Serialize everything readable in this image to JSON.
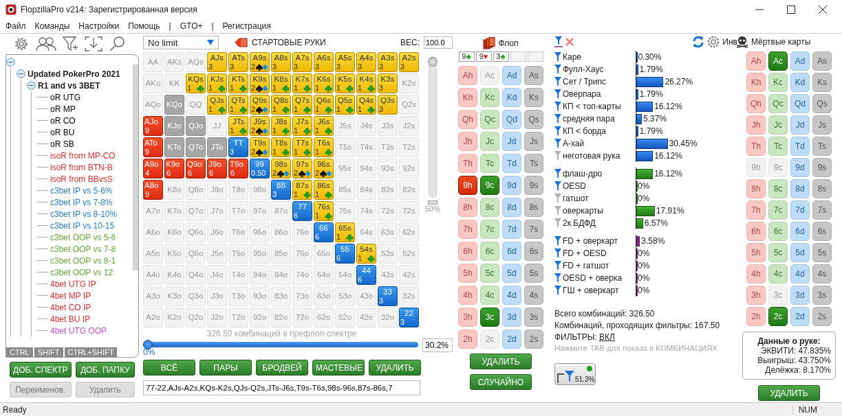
{
  "window": {
    "title": "FlopzillaPro v214: Зарегистрированная версия"
  },
  "menu": [
    "Файл",
    "Команды",
    "Настройки",
    "Помощь",
    "|",
    "GTO+",
    "|",
    "Регистрация"
  ],
  "tree": {
    "expanded": true,
    "children": [
      {
        "label": "Updated PokerPro 2021",
        "expanded": true,
        "children": [
          {
            "label": "R1 and vs 3BET",
            "expanded": true,
            "children": [
              {
                "label": "oR UTG",
                "color": "#000000"
              },
              {
                "label": "oR MP",
                "color": "#000000"
              },
              {
                "label": "oR CO",
                "color": "#000000"
              },
              {
                "label": "oR BU",
                "color": "#000000"
              },
              {
                "label": "oR SB",
                "color": "#000000"
              },
              {
                "label": "isoR from MP-CO",
                "color": "#d83030"
              },
              {
                "label": "isoR from BTN-B",
                "color": "#d83030"
              },
              {
                "label": "isoR from BBvsS",
                "color": "#d83030"
              },
              {
                "label": "c3bet IP vs 5-6%",
                "color": "#2a7fc0"
              },
              {
                "label": "c3bet IP vs 7-8%",
                "color": "#2a7fc0"
              },
              {
                "label": "c3bet IP vs 8-10%",
                "color": "#2a7fc0"
              },
              {
                "label": "c3bet IP vs 10-15",
                "color": "#2a7fc0"
              },
              {
                "label": "c3bet OOP vs 5-6",
                "color": "#6aa63a"
              },
              {
                "label": "c3bet OOP vs 7-8",
                "color": "#6aa63a"
              },
              {
                "label": "c3bet OOP vs 8-1",
                "color": "#6aa63a"
              },
              {
                "label": "c3bet OOP vs 12",
                "color": "#6aa63a"
              },
              {
                "label": "4bet UTG IP",
                "color": "#d83030"
              },
              {
                "label": "4bet MP IP",
                "color": "#d83030"
              },
              {
                "label": "4bet CO IP",
                "color": "#d83030"
              },
              {
                "label": "4bet BU IP",
                "color": "#d83030"
              },
              {
                "label": "4bet UTG OOP",
                "color": "#c850c8"
              }
            ]
          }
        ]
      }
    ]
  },
  "modifier_tabs": [
    "CTRL",
    "SHIFT",
    "CTRL+SHIFT"
  ],
  "range_buttons": [
    {
      "label": "ДОБ. СПЕКТР",
      "disabled": false
    },
    {
      "label": "ДОБ. ПАПКУ",
      "disabled": false
    },
    {
      "label": "Переименов.",
      "disabled": true
    },
    {
      "label": "Удалить",
      "disabled": true
    }
  ],
  "matrix": {
    "game_select": "No limit",
    "title": "СТАРТОВЫЕ РУКИ",
    "weight_label": "ВЕС:",
    "weight_value": "100.0",
    "rows": [
      [
        {
          "label": "AA",
          "kind": "empty"
        },
        {
          "label": "AKs",
          "kind": "empty"
        },
        {
          "label": "AQs",
          "kind": "empty"
        },
        {
          "label": "AJs",
          "kind": "yellow",
          "count": "3"
        },
        {
          "label": "ATs",
          "kind": "yellow",
          "count": "3"
        },
        {
          "label": "A9s",
          "kind": "yellow",
          "count": "2",
          "suit_icon": {
            "kind": "spade_diamond"
          }
        },
        {
          "label": "A8s",
          "kind": "yellow",
          "count": "3"
        },
        {
          "label": "A7s",
          "kind": "yellow",
          "count": "3"
        },
        {
          "label": "A6s",
          "kind": "yellow",
          "count": "3"
        },
        {
          "label": "A5s",
          "kind": "yellow",
          "count": "3"
        },
        {
          "label": "A4s",
          "kind": "yellow",
          "count": "3"
        },
        {
          "label": "A3s",
          "kind": "yellow",
          "count": "3"
        },
        {
          "label": "A2s",
          "kind": "yellow",
          "count": "3"
        }
      ],
      [
        {
          "label": "AKo",
          "kind": "empty"
        },
        {
          "label": "KK",
          "kind": "empty"
        },
        {
          "label": "KQs",
          "kind": "yellow",
          "count": "1",
          "suit_icon": {
            "kind": "club"
          }
        },
        {
          "label": "KJs",
          "kind": "yellow",
          "count": "1",
          "suit_icon": {
            "kind": "club"
          }
        },
        {
          "label": "KTs",
          "kind": "yellow",
          "count": "1",
          "suit_icon": {
            "kind": "club"
          }
        },
        {
          "label": "K9s",
          "kind": "yellow",
          "count": "2",
          "suit_icon": {
            "kind": "spade_diamond"
          }
        },
        {
          "label": "K8s",
          "kind": "yellow",
          "count": "1",
          "suit_icon": {
            "kind": "club"
          }
        },
        {
          "label": "K7s",
          "kind": "yellow",
          "count": "1",
          "suit_icon": {
            "kind": "club"
          }
        },
        {
          "label": "K6s",
          "kind": "yellow",
          "count": "1",
          "suit_icon": {
            "kind": "club"
          }
        },
        {
          "label": "K5s",
          "kind": "yellow",
          "count": "1",
          "suit_icon": {
            "kind": "club"
          }
        },
        {
          "label": "K4s",
          "kind": "yellow",
          "count": "1",
          "suit_icon": {
            "kind": "club"
          }
        },
        {
          "label": "K3s",
          "kind": "yellow",
          "count": "3"
        },
        {
          "label": "K2s",
          "kind": "empty"
        }
      ],
      [
        {
          "label": "AQo",
          "kind": "empty"
        },
        {
          "label": "KQo",
          "kind": "gray"
        },
        {
          "label": "QQ",
          "kind": "empty"
        },
        {
          "label": "QJs",
          "kind": "yellow",
          "count": "1",
          "suit_icon": {
            "kind": "club"
          }
        },
        {
          "label": "QTs",
          "kind": "yellow",
          "count": "1",
          "suit_icon": {
            "kind": "club"
          }
        },
        {
          "label": "Q9s",
          "kind": "yellow",
          "count": "2",
          "suit_icon": {
            "kind": "spade_diamond"
          }
        },
        {
          "label": "Q8s",
          "kind": "yellow",
          "count": "1",
          "suit_icon": {
            "kind": "club"
          }
        },
        {
          "label": "Q7s",
          "kind": "yellow",
          "count": "1",
          "suit_icon": {
            "kind": "club"
          }
        },
        {
          "label": "Q6s",
          "kind": "yellow",
          "count": "1",
          "suit_icon": {
            "kind": "club"
          }
        },
        {
          "label": "Q5s",
          "kind": "yellow",
          "count": "1",
          "suit_icon": {
            "kind": "club"
          }
        },
        {
          "label": "Q4s",
          "kind": "yellow",
          "count": "1",
          "suit_icon": {
            "kind": "club"
          }
        },
        {
          "label": "Q3s",
          "kind": "yellow",
          "count": "3"
        },
        {
          "label": "Q2s",
          "kind": "empty"
        }
      ],
      [
        {
          "label": "AJo",
          "kind": "red",
          "count": "9"
        },
        {
          "label": "KJo",
          "kind": "gray"
        },
        {
          "label": "QJo",
          "kind": "gray"
        },
        {
          "label": "JJ",
          "kind": "empty"
        },
        {
          "label": "JTs",
          "kind": "yellow",
          "count": "1",
          "suit_icon": {
            "kind": "club"
          }
        },
        {
          "label": "J9s",
          "kind": "yellow",
          "count": "2",
          "suit_icon": {
            "kind": "spade_diamond"
          }
        },
        {
          "label": "J8s",
          "kind": "yellow",
          "count": "1",
          "suit_icon": {
            "kind": "club"
          }
        },
        {
          "label": "J7s",
          "kind": "yellow",
          "count": "1",
          "suit_icon": {
            "kind": "club"
          }
        },
        {
          "label": "J6s",
          "kind": "yellow",
          "count": "1",
          "suit_icon": {
            "kind": "club"
          }
        },
        {
          "label": "J5s",
          "kind": "empty"
        },
        {
          "label": "J4s",
          "kind": "empty"
        },
        {
          "label": "J3s",
          "kind": "empty"
        },
        {
          "label": "J2s",
          "kind": "empty"
        }
      ],
      [
        {
          "label": "ATo",
          "kind": "red",
          "count": "9"
        },
        {
          "label": "KTo",
          "kind": "gray"
        },
        {
          "label": "QTo",
          "kind": "gray"
        },
        {
          "label": "JTo",
          "kind": "gray"
        },
        {
          "label": "TT",
          "kind": "blue",
          "count": "3"
        },
        {
          "label": "T9s",
          "kind": "yellow",
          "count": "2",
          "suit_icon": {
            "kind": "spade_diamond"
          }
        },
        {
          "label": "T8s",
          "kind": "yellow",
          "count": "1",
          "suit_icon": {
            "kind": "club"
          }
        },
        {
          "label": "T7s",
          "kind": "yellow",
          "count": "1",
          "suit_icon": {
            "kind": "club"
          }
        },
        {
          "label": "T6s",
          "kind": "yellow",
          "count": "1",
          "suit_icon": {
            "kind": "club"
          }
        },
        {
          "label": "T5s",
          "kind": "empty"
        },
        {
          "label": "T4s",
          "kind": "empty"
        },
        {
          "label": "T3s",
          "kind": "empty"
        },
        {
          "label": "T2s",
          "kind": "empty"
        }
      ],
      [
        {
          "label": "A9o",
          "kind": "red",
          "count": "4"
        },
        {
          "label": "K9o",
          "kind": "red",
          "count": "6"
        },
        {
          "label": "Q9o",
          "kind": "red",
          "count": "6"
        },
        {
          "label": "J9o",
          "kind": "red",
          "count": "6"
        },
        {
          "label": "T9o",
          "kind": "red",
          "count": "6"
        },
        {
          "label": "99",
          "kind": "blue",
          "count": "0.50"
        },
        {
          "label": "98s",
          "kind": "yellow",
          "count": "2",
          "suit_icon": {
            "kind": "spade_diamond"
          }
        },
        {
          "label": "97s",
          "kind": "yellow",
          "count": "2",
          "suit_icon": {
            "kind": "spade_diamond"
          }
        },
        {
          "label": "96s",
          "kind": "yellow",
          "count": "2",
          "suit_icon": {
            "kind": "spade_diamond"
          }
        },
        {
          "label": "95s",
          "kind": "empty"
        },
        {
          "label": "94s",
          "kind": "empty"
        },
        {
          "label": "93s",
          "kind": "empty"
        },
        {
          "label": "92s",
          "kind": "empty"
        }
      ],
      [
        {
          "label": "A8o",
          "kind": "red",
          "count": "9"
        },
        {
          "label": "K8o",
          "kind": "empty"
        },
        {
          "label": "Q8o",
          "kind": "empty"
        },
        {
          "label": "J8o",
          "kind": "empty"
        },
        {
          "label": "T8o",
          "kind": "empty"
        },
        {
          "label": "98o",
          "kind": "empty"
        },
        {
          "label": "88",
          "kind": "blue",
          "count": "3"
        },
        {
          "label": "87s",
          "kind": "yellow",
          "count": "1",
          "suit_icon": {
            "kind": "club"
          }
        },
        {
          "label": "86s",
          "kind": "yellow",
          "count": "1",
          "suit_icon": {
            "kind": "club"
          }
        },
        {
          "label": "85s",
          "kind": "empty"
        },
        {
          "label": "84s",
          "kind": "empty"
        },
        {
          "label": "83s",
          "kind": "empty"
        },
        {
          "label": "82s",
          "kind": "empty"
        }
      ],
      [
        {
          "label": "A7o",
          "kind": "empty"
        },
        {
          "label": "K7o",
          "kind": "empty"
        },
        {
          "label": "Q7o",
          "kind": "empty"
        },
        {
          "label": "J7o",
          "kind": "empty"
        },
        {
          "label": "T7o",
          "kind": "empty"
        },
        {
          "label": "97o",
          "kind": "empty"
        },
        {
          "label": "87o",
          "kind": "empty"
        },
        {
          "label": "77",
          "kind": "blue",
          "count": "6"
        },
        {
          "label": "76s",
          "kind": "yellow",
          "count": "1",
          "suit_icon": {
            "kind": "club"
          }
        },
        {
          "label": "75s",
          "kind": "empty"
        },
        {
          "label": "74s",
          "kind": "empty"
        },
        {
          "label": "73s",
          "kind": "empty"
        },
        {
          "label": "72s",
          "kind": "empty"
        }
      ],
      [
        {
          "label": "A6o",
          "kind": "empty"
        },
        {
          "label": "K6o",
          "kind": "empty"
        },
        {
          "label": "Q6o",
          "kind": "empty"
        },
        {
          "label": "J6o",
          "kind": "empty"
        },
        {
          "label": "T6o",
          "kind": "empty"
        },
        {
          "label": "96o",
          "kind": "empty"
        },
        {
          "label": "86o",
          "kind": "empty"
        },
        {
          "label": "76o",
          "kind": "empty"
        },
        {
          "label": "66",
          "kind": "blue",
          "count": "6"
        },
        {
          "label": "65s",
          "kind": "yellow",
          "count": "1",
          "suit_icon": {
            "kind": "club"
          }
        },
        {
          "label": "64s",
          "kind": "empty"
        },
        {
          "label": "63s",
          "kind": "empty"
        },
        {
          "label": "62s",
          "kind": "empty"
        }
      ],
      [
        {
          "label": "A5o",
          "kind": "empty"
        },
        {
          "label": "K5o",
          "kind": "empty"
        },
        {
          "label": "Q5o",
          "kind": "empty"
        },
        {
          "label": "J5o",
          "kind": "empty"
        },
        {
          "label": "T5o",
          "kind": "empty"
        },
        {
          "label": "95o",
          "kind": "empty"
        },
        {
          "label": "85o",
          "kind": "empty"
        },
        {
          "label": "75o",
          "kind": "empty"
        },
        {
          "label": "65o",
          "kind": "empty"
        },
        {
          "label": "55",
          "kind": "blue",
          "count": "6"
        },
        {
          "label": "54s",
          "kind": "yellow",
          "count": "1",
          "suit_icon": {
            "kind": "club"
          }
        },
        {
          "label": "53s",
          "kind": "empty"
        },
        {
          "label": "52s",
          "kind": "empty"
        }
      ],
      [
        {
          "label": "A4o",
          "kind": "empty"
        },
        {
          "label": "K4o",
          "kind": "empty"
        },
        {
          "label": "Q4o",
          "kind": "empty"
        },
        {
          "label": "J4o",
          "kind": "empty"
        },
        {
          "label": "T4o",
          "kind": "empty"
        },
        {
          "label": "94o",
          "kind": "empty"
        },
        {
          "label": "84o",
          "kind": "empty"
        },
        {
          "label": "74o",
          "kind": "empty"
        },
        {
          "label": "64o",
          "kind": "empty"
        },
        {
          "label": "54o",
          "kind": "empty"
        },
        {
          "label": "44",
          "kind": "blue",
          "count": "6"
        },
        {
          "label": "43s",
          "kind": "empty"
        },
        {
          "label": "42s",
          "kind": "empty"
        }
      ],
      [
        {
          "label": "A3o",
          "kind": "empty"
        },
        {
          "label": "K3o",
          "kind": "empty"
        },
        {
          "label": "Q3o",
          "kind": "empty"
        },
        {
          "label": "J3o",
          "kind": "empty"
        },
        {
          "label": "T3o",
          "kind": "empty"
        },
        {
          "label": "93o",
          "kind": "empty"
        },
        {
          "label": "83o",
          "kind": "empty"
        },
        {
          "label": "73o",
          "kind": "empty"
        },
        {
          "label": "63o",
          "kind": "empty"
        },
        {
          "label": "53o",
          "kind": "empty"
        },
        {
          "label": "43o",
          "kind": "empty"
        },
        {
          "label": "33",
          "kind": "blue",
          "count": "3"
        },
        {
          "label": "32s",
          "kind": "empty"
        }
      ],
      [
        {
          "label": "A2o",
          "kind": "empty"
        },
        {
          "label": "K2o",
          "kind": "empty"
        },
        {
          "label": "Q2o",
          "kind": "empty"
        },
        {
          "label": "J2o",
          "kind": "empty"
        },
        {
          "label": "T2o",
          "kind": "empty"
        },
        {
          "label": "92o",
          "kind": "empty"
        },
        {
          "label": "82o",
          "kind": "empty"
        },
        {
          "label": "72o",
          "kind": "empty"
        },
        {
          "label": "62o",
          "kind": "empty"
        },
        {
          "label": "52o",
          "kind": "empty"
        },
        {
          "label": "42o",
          "kind": "empty"
        },
        {
          "label": "32o",
          "kind": "empty"
        },
        {
          "label": "22",
          "kind": "blue",
          "count": "3"
        }
      ]
    ],
    "weight_slider": {
      "level": 1,
      "marker": "50%"
    },
    "combo_caption": "326.50 комбинаций в префлоп-спектре",
    "range_slider": {
      "level": 0,
      "min_label": "0%",
      "value": "30.2%"
    },
    "buttons": [
      "ВСЁ",
      "ПАРЫ",
      "БРОДВЕЙ",
      "МАСТЕВЫЕ",
      "УДАЛИТЬ"
    ],
    "range_text": "77-22,AJs-A2s,KQs-K2s,QJs-Q2s,JTs-J6s,T9s-T6s,98s-96s,87s-86s,7"
  },
  "flop": {
    "title": "Флоп",
    "slots": [
      {
        "filled": true,
        "rank": "9",
        "suit": "♣",
        "color": "#189a18"
      },
      {
        "filled": true,
        "rank": "9",
        "suit": "♥",
        "color": "#e01010"
      },
      {
        "filled": true,
        "rank": "3",
        "suit": "♣",
        "color": "#189a18"
      },
      {
        "filled": false
      },
      {
        "filled": false
      }
    ],
    "cards": [
      [
        {
          "label": "Ah",
          "selected": false,
          "disabled": false
        },
        {
          "label": "Ac",
          "selected": false,
          "disabled": true
        },
        {
          "label": "Ad",
          "selected": false,
          "disabled": false
        },
        {
          "label": "As",
          "selected": false,
          "disabled": false
        }
      ],
      [
        {
          "label": "Kh",
          "selected": false,
          "disabled": false
        },
        {
          "label": "Kc",
          "selected": false,
          "disabled": false
        },
        {
          "label": "Kd",
          "selected": false,
          "disabled": false
        },
        {
          "label": "Ks",
          "selected": false,
          "disabled": false
        }
      ],
      [
        {
          "label": "Qh",
          "selected": false,
          "disabled": false
        },
        {
          "label": "Qc",
          "selected": false,
          "disabled": false
        },
        {
          "label": "Qd",
          "selected": false,
          "disabled": false
        },
        {
          "label": "Qs",
          "selected": false,
          "disabled": false
        }
      ],
      [
        {
          "label": "Jh",
          "selected": false,
          "disabled": false
        },
        {
          "label": "Jc",
          "selected": false,
          "disabled": false
        },
        {
          "label": "Jd",
          "selected": false,
          "disabled": false
        },
        {
          "label": "Js",
          "selected": false,
          "disabled": false
        }
      ],
      [
        {
          "label": "Th",
          "selected": false,
          "disabled": false
        },
        {
          "label": "Tc",
          "selected": false,
          "disabled": false
        },
        {
          "label": "Td",
          "selected": false,
          "disabled": false
        },
        {
          "label": "Ts",
          "selected": false,
          "disabled": false
        }
      ],
      [
        {
          "label": "9h",
          "selected": true,
          "disabled": false
        },
        {
          "label": "9c",
          "selected": true,
          "disabled": false
        },
        {
          "label": "9d",
          "selected": false,
          "disabled": false
        },
        {
          "label": "9s",
          "selected": false,
          "disabled": false
        }
      ],
      [
        {
          "label": "8h",
          "selected": false,
          "disabled": false
        },
        {
          "label": "8c",
          "selected": false,
          "disabled": false
        },
        {
          "label": "8d",
          "selected": false,
          "disabled": false
        },
        {
          "label": "8s",
          "selected": false,
          "disabled": false
        }
      ],
      [
        {
          "label": "7h",
          "selected": false,
          "disabled": false
        },
        {
          "label": "7c",
          "selected": false,
          "disabled": false
        },
        {
          "label": "7d",
          "selected": false,
          "disabled": false
        },
        {
          "label": "7s",
          "selected": false,
          "disabled": false
        }
      ],
      [
        {
          "label": "6h",
          "selected": false,
          "disabled": false
        },
        {
          "label": "6c",
          "selected": false,
          "disabled": false
        },
        {
          "label": "6d",
          "selected": false,
          "disabled": false
        },
        {
          "label": "6s",
          "selected": false,
          "disabled": false
        }
      ],
      [
        {
          "label": "5h",
          "selected": false,
          "disabled": false
        },
        {
          "label": "5c",
          "selected": false,
          "disabled": false
        },
        {
          "label": "5d",
          "selected": false,
          "disabled": false
        },
        {
          "label": "5s",
          "selected": false,
          "disabled": false
        }
      ],
      [
        {
          "label": "4h",
          "selected": false,
          "disabled": false
        },
        {
          "label": "4c",
          "selected": false,
          "disabled": false
        },
        {
          "label": "4d",
          "selected": false,
          "disabled": false
        },
        {
          "label": "4s",
          "selected": false,
          "disabled": false
        }
      ],
      [
        {
          "label": "3h",
          "selected": false,
          "disabled": false
        },
        {
          "label": "3c",
          "selected": true,
          "disabled": false
        },
        {
          "label": "3d",
          "selected": false,
          "disabled": false
        },
        {
          "label": "3s",
          "selected": false,
          "disabled": false
        }
      ],
      [
        {
          "label": "2h",
          "selected": false,
          "disabled": false
        },
        {
          "label": "2c",
          "selected": false,
          "disabled": true
        },
        {
          "label": "2d",
          "selected": false,
          "disabled": false
        },
        {
          "label": "2s",
          "selected": false,
          "disabled": false
        }
      ]
    ],
    "buttons": [
      "УДАЛИТЬ",
      "СЛУЧАЙНО"
    ]
  },
  "stats": {
    "invert_label": "Инв",
    "groups": [
      {
        "kind": "made",
        "rows": [
          {
            "label": "Каре",
            "filter_on": true,
            "value": "0.30%",
            "level": 0.003
          },
          {
            "label": "Фулл-Хаус",
            "filter_on": true,
            "value": "1.79%",
            "level": 0.0179
          },
          {
            "label": "Сет / Трипс",
            "filter_on": true,
            "value": "26.27%",
            "level": 0.2627
          },
          {
            "label": "Оверпара",
            "filter_on": true,
            "value": "1.79%",
            "level": 0.0179
          },
          {
            "label": "КП < топ-карты",
            "filter_on": true,
            "value": "16.12%",
            "level": 0.1612
          },
          {
            "label": "средняя пара",
            "filter_on": true,
            "value": "5.37%",
            "level": 0.0537
          },
          {
            "label": "КП < борда",
            "filter_on": true,
            "value": "1.79%",
            "level": 0.0179
          },
          {
            "label": "А-хай",
            "filter_on": true,
            "value": "30.45%",
            "level": 0.3045
          },
          {
            "label": "неготовая рука",
            "filter_on": false,
            "value": "16.12%",
            "level": 0.1612
          }
        ]
      },
      {
        "kind": "draw",
        "rows": [
          {
            "label": "флаш-дро",
            "filter_on": true,
            "value": "16.12%",
            "level": 0.1612
          },
          {
            "label": "OESD",
            "filter_on": true,
            "value": "0%",
            "level": 0
          },
          {
            "label": "гатшот",
            "filter_on": false,
            "value": "0%",
            "level": 0
          },
          {
            "label": "оверкарты",
            "filter_on": false,
            "value": "17.91%",
            "level": 0.1791
          },
          {
            "label": "2к БДФД",
            "filter_on": false,
            "value": "6.57%",
            "level": 0.0657
          }
        ]
      },
      {
        "kind": "combo",
        "rows": [
          {
            "label": "FD + оверкарт",
            "filter_on": true,
            "value": "3.58%",
            "level": 0.0358
          },
          {
            "label": "FD + OESD",
            "filter_on": true,
            "value": "0%",
            "level": 0
          },
          {
            "label": "FD + гатшот",
            "filter_on": true,
            "value": "0%",
            "level": 0
          },
          {
            "label": "OESD + оверка",
            "filter_on": true,
            "value": "0%",
            "level": 0
          },
          {
            "label": "ГШ + оверкарт",
            "filter_on": true,
            "value": "0%",
            "level": 0
          }
        ]
      }
    ],
    "total": "Всего комбинаций: 326.50",
    "passing": "Комбинаций, проходящих фильтры: 167.50",
    "filters_label": "ФИЛЬТРЫ:",
    "filters_state": "ВКЛ",
    "hint": "Нажмите TAB для показа в КОМБИНАЦИЯХ",
    "filter_button": {
      "value": "51.3%",
      "on": true
    }
  },
  "dead_cards": {
    "title": "Мёртвые карты",
    "cards": [
      [
        {
          "label": "Ah",
          "selected": false,
          "disabled": false
        },
        {
          "label": "Ac",
          "selected": true,
          "disabled": false
        },
        {
          "label": "Ad",
          "selected": false,
          "disabled": false
        },
        {
          "label": "As",
          "selected": false,
          "disabled": false
        }
      ],
      [
        {
          "label": "Kh",
          "selected": false,
          "disabled": false
        },
        {
          "label": "Kc",
          "selected": false,
          "disabled": false
        },
        {
          "label": "Kd",
          "selected": false,
          "disabled": false
        },
        {
          "label": "Ks",
          "selected": false,
          "disabled": false
        }
      ],
      [
        {
          "label": "Qh",
          "selected": false,
          "disabled": false
        },
        {
          "label": "Qc",
          "selected": false,
          "disabled": false
        },
        {
          "label": "Qd",
          "selected": false,
          "disabled": false
        },
        {
          "label": "Qs",
          "selected": false,
          "disabled": false
        }
      ],
      [
        {
          "label": "Jh",
          "selected": false,
          "disabled": false
        },
        {
          "label": "Jc",
          "selected": false,
          "disabled": false
        },
        {
          "label": "Jd",
          "selected": false,
          "disabled": false
        },
        {
          "label": "Js",
          "selected": false,
          "disabled": false
        }
      ],
      [
        {
          "label": "Th",
          "selected": false,
          "disabled": false
        },
        {
          "label": "Tc",
          "selected": false,
          "disabled": false
        },
        {
          "label": "Td",
          "selected": false,
          "disabled": false
        },
        {
          "label": "Ts",
          "selected": false,
          "disabled": false
        }
      ],
      [
        {
          "label": "9h",
          "selected": false,
          "disabled": true
        },
        {
          "label": "9c",
          "selected": false,
          "disabled": true
        },
        {
          "label": "9d",
          "selected": false,
          "disabled": false
        },
        {
          "label": "9s",
          "selected": false,
          "disabled": false
        }
      ],
      [
        {
          "label": "8h",
          "selected": false,
          "disabled": false
        },
        {
          "label": "8c",
          "selected": false,
          "disabled": false
        },
        {
          "label": "8d",
          "selected": false,
          "disabled": false
        },
        {
          "label": "8s",
          "selected": false,
          "disabled": false
        }
      ],
      [
        {
          "label": "7h",
          "selected": false,
          "disabled": false
        },
        {
          "label": "7c",
          "selected": false,
          "disabled": false
        },
        {
          "label": "7d",
          "selected": false,
          "disabled": false
        },
        {
          "label": "7s",
          "selected": false,
          "disabled": false
        }
      ],
      [
        {
          "label": "6h",
          "selected": false,
          "disabled": false
        },
        {
          "label": "6c",
          "selected": false,
          "disabled": false
        },
        {
          "label": "6d",
          "selected": false,
          "disabled": false
        },
        {
          "label": "6s",
          "selected": false,
          "disabled": false
        }
      ],
      [
        {
          "label": "5h",
          "selected": false,
          "disabled": false
        },
        {
          "label": "5c",
          "selected": false,
          "disabled": false
        },
        {
          "label": "5d",
          "selected": false,
          "disabled": false
        },
        {
          "label": "5s",
          "selected": false,
          "disabled": false
        }
      ],
      [
        {
          "label": "4h",
          "selected": false,
          "disabled": false
        },
        {
          "label": "4c",
          "selected": false,
          "disabled": false
        },
        {
          "label": "4d",
          "selected": false,
          "disabled": false
        },
        {
          "label": "4s",
          "selected": false,
          "disabled": false
        }
      ],
      [
        {
          "label": "3h",
          "selected": false,
          "disabled": false
        },
        {
          "label": "3c",
          "selected": false,
          "disabled": true
        },
        {
          "label": "3d",
          "selected": false,
          "disabled": false
        },
        {
          "label": "3s",
          "selected": false,
          "disabled": false
        }
      ],
      [
        {
          "label": "2h",
          "selected": false,
          "disabled": false
        },
        {
          "label": "2c",
          "selected": true,
          "disabled": false
        },
        {
          "label": "2d",
          "selected": false,
          "disabled": false
        },
        {
          "label": "2s",
          "selected": false,
          "disabled": false
        }
      ]
    ],
    "button": "УДАЛИТЬ"
  },
  "hand_info": {
    "title": "Данные о руке:",
    "lines": [
      "ЭКВИТИ: 47.835%",
      "Выигрыш: 43.750%",
      "Делёжка: 8.170%"
    ]
  },
  "status_bar": {
    "text": "Ready",
    "indicator": "NUM"
  }
}
